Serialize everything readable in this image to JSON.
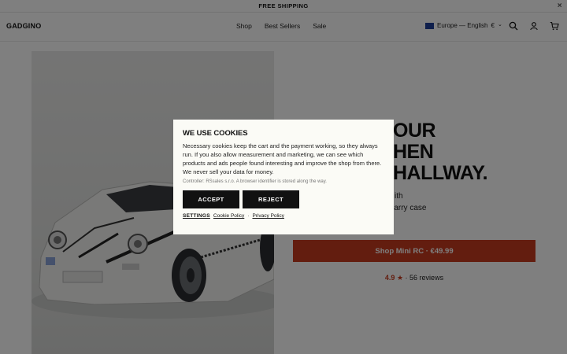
{
  "announcement": {
    "text": "FREE SHIPPING",
    "close_glyph": "×"
  },
  "header": {
    "logo": "GADGINO",
    "nav": [
      "Shop",
      "Best Sellers",
      "Sale"
    ],
    "locale": {
      "label": "Europe — English",
      "currency": "€",
      "chevron": "⌄",
      "flag_color": "#1f3f99"
    },
    "icons": [
      "search-icon",
      "account-icon",
      "cart-icon"
    ]
  },
  "hero": {
    "headline_lines": [
      "OUR",
      "HEN",
      "HALLWAY."
    ],
    "feature_lines": [
      "ith",
      "ts, carry case"
    ],
    "shop_button": "Shop Mini RC · €49.99",
    "rating": {
      "score": "4.9",
      "star": "★",
      "separator": "·",
      "reviews": "56 reviews"
    },
    "accent_color": "#c73a1e"
  },
  "cookie_modal": {
    "title": "WE USE COOKIES",
    "body": "Necessary cookies keep the cart and the payment working, so they always run. If you also allow measurement and marketing, we can see which products and ads people found interesting and improve the shop from there. We never sell your data for money.",
    "fine_print": "Controller: RSsales s.r.o. A browser identifier is stored along the way.",
    "accept": "ACCEPT",
    "reject": "REJECT",
    "settings": "SETTINGS",
    "cookie_policy": "Cookie Policy",
    "separator": "·",
    "privacy_policy": "Privacy Policy"
  }
}
